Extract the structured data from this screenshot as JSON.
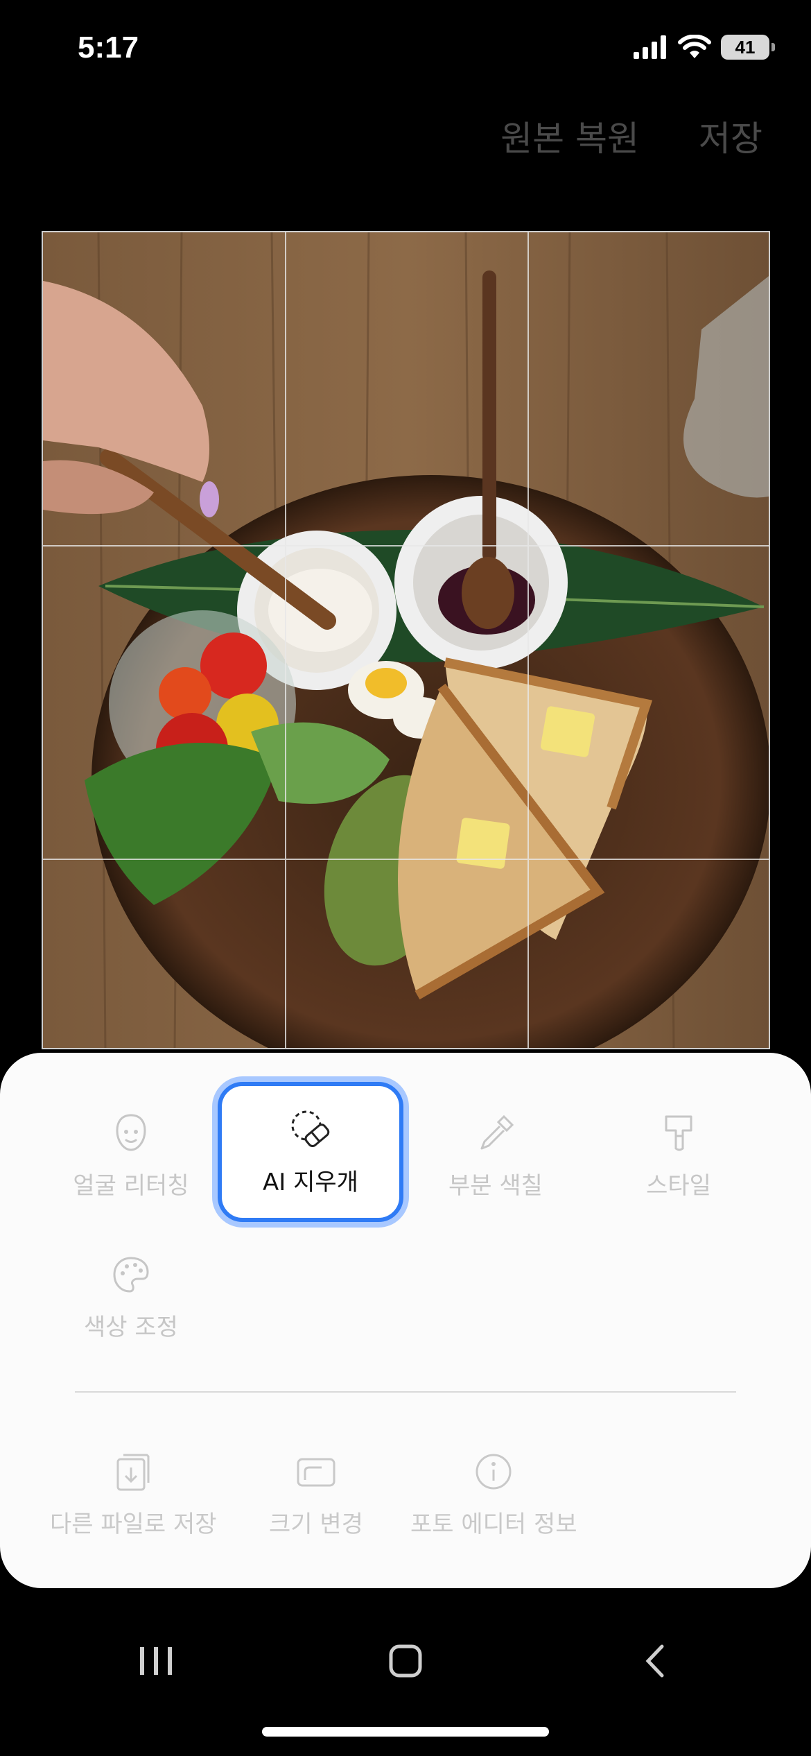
{
  "status": {
    "time": "5:17",
    "battery": "41"
  },
  "top_actions": {
    "restore": "원본 복원",
    "save": "저장"
  },
  "tools": [
    {
      "label": "얼굴 리터칭",
      "icon": "face-icon"
    },
    {
      "label": "AI 지우개",
      "icon": "eraser-icon",
      "selected": true
    },
    {
      "label": "부분 색칠",
      "icon": "eyedropper-icon"
    },
    {
      "label": "스타일",
      "icon": "paintbrush-icon"
    },
    {
      "label": "색상 조정",
      "icon": "palette-icon"
    }
  ],
  "actions": [
    {
      "label": "다른 파일로 저장",
      "icon": "save-as-icon"
    },
    {
      "label": "크기 변경",
      "icon": "resize-icon"
    },
    {
      "label": "포토 에디터 정보",
      "icon": "info-icon"
    }
  ],
  "colors": {
    "accent": "#2f7bf5",
    "sheet": "#fbfbfb",
    "disabled": "#c6c6c6"
  }
}
